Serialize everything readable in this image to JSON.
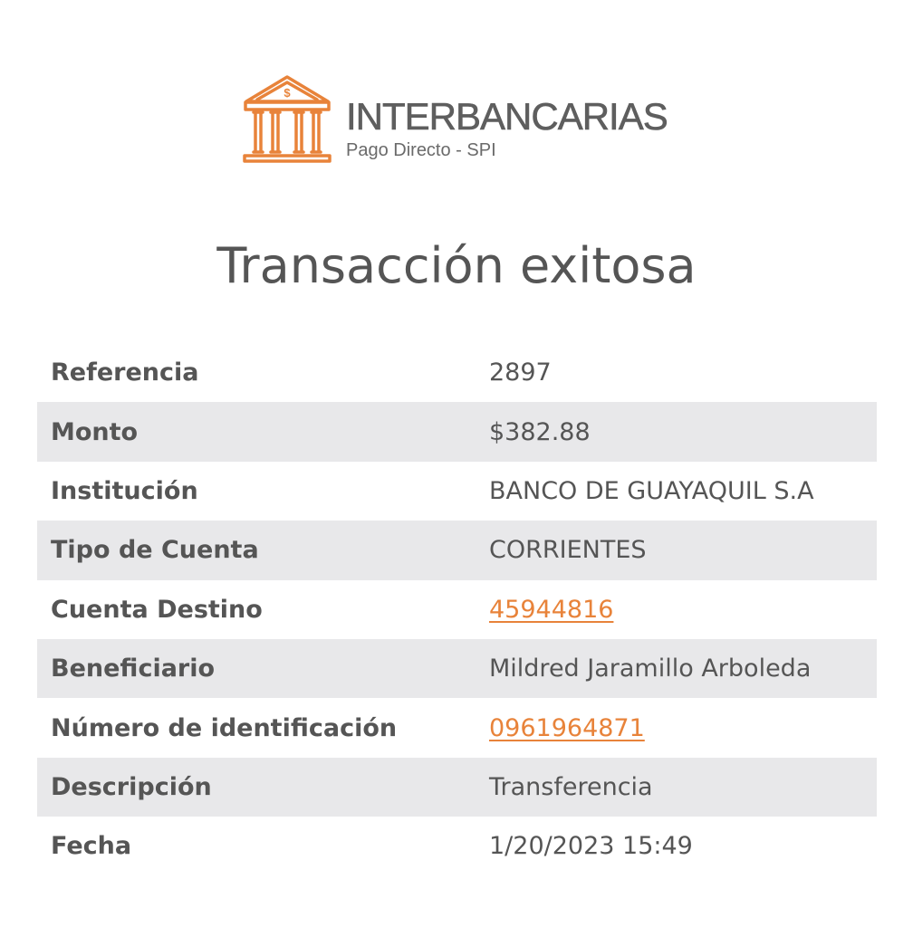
{
  "brand": {
    "name": "INTERBANCARIAS",
    "subtitle": "Pago Directo - SPI",
    "icon": "bank-icon",
    "icon_symbol": "$",
    "accent_color": "#e8833a"
  },
  "title": "Transacción exitosa",
  "details": {
    "referencia": {
      "label": "Referencia",
      "value": "2897"
    },
    "monto": {
      "label": "Monto",
      "value": "$382.88"
    },
    "institucion": {
      "label": "Institución",
      "value": "BANCO DE GUAYAQUIL S.A"
    },
    "tipo_cuenta": {
      "label": "Tipo de Cuenta",
      "value": "CORRIENTES"
    },
    "cuenta_destino": {
      "label": "Cuenta Destino",
      "value": "45944816"
    },
    "beneficiario": {
      "label": "Beneficiario",
      "value": "Mildred Jaramillo Arboleda"
    },
    "identificacion": {
      "label": "Número de identificación",
      "value": "0961964871"
    },
    "descripcion": {
      "label": "Descripción",
      "value": "Transferencia"
    },
    "fecha": {
      "label": "Fecha",
      "value": "1/20/2023 15:49"
    }
  }
}
